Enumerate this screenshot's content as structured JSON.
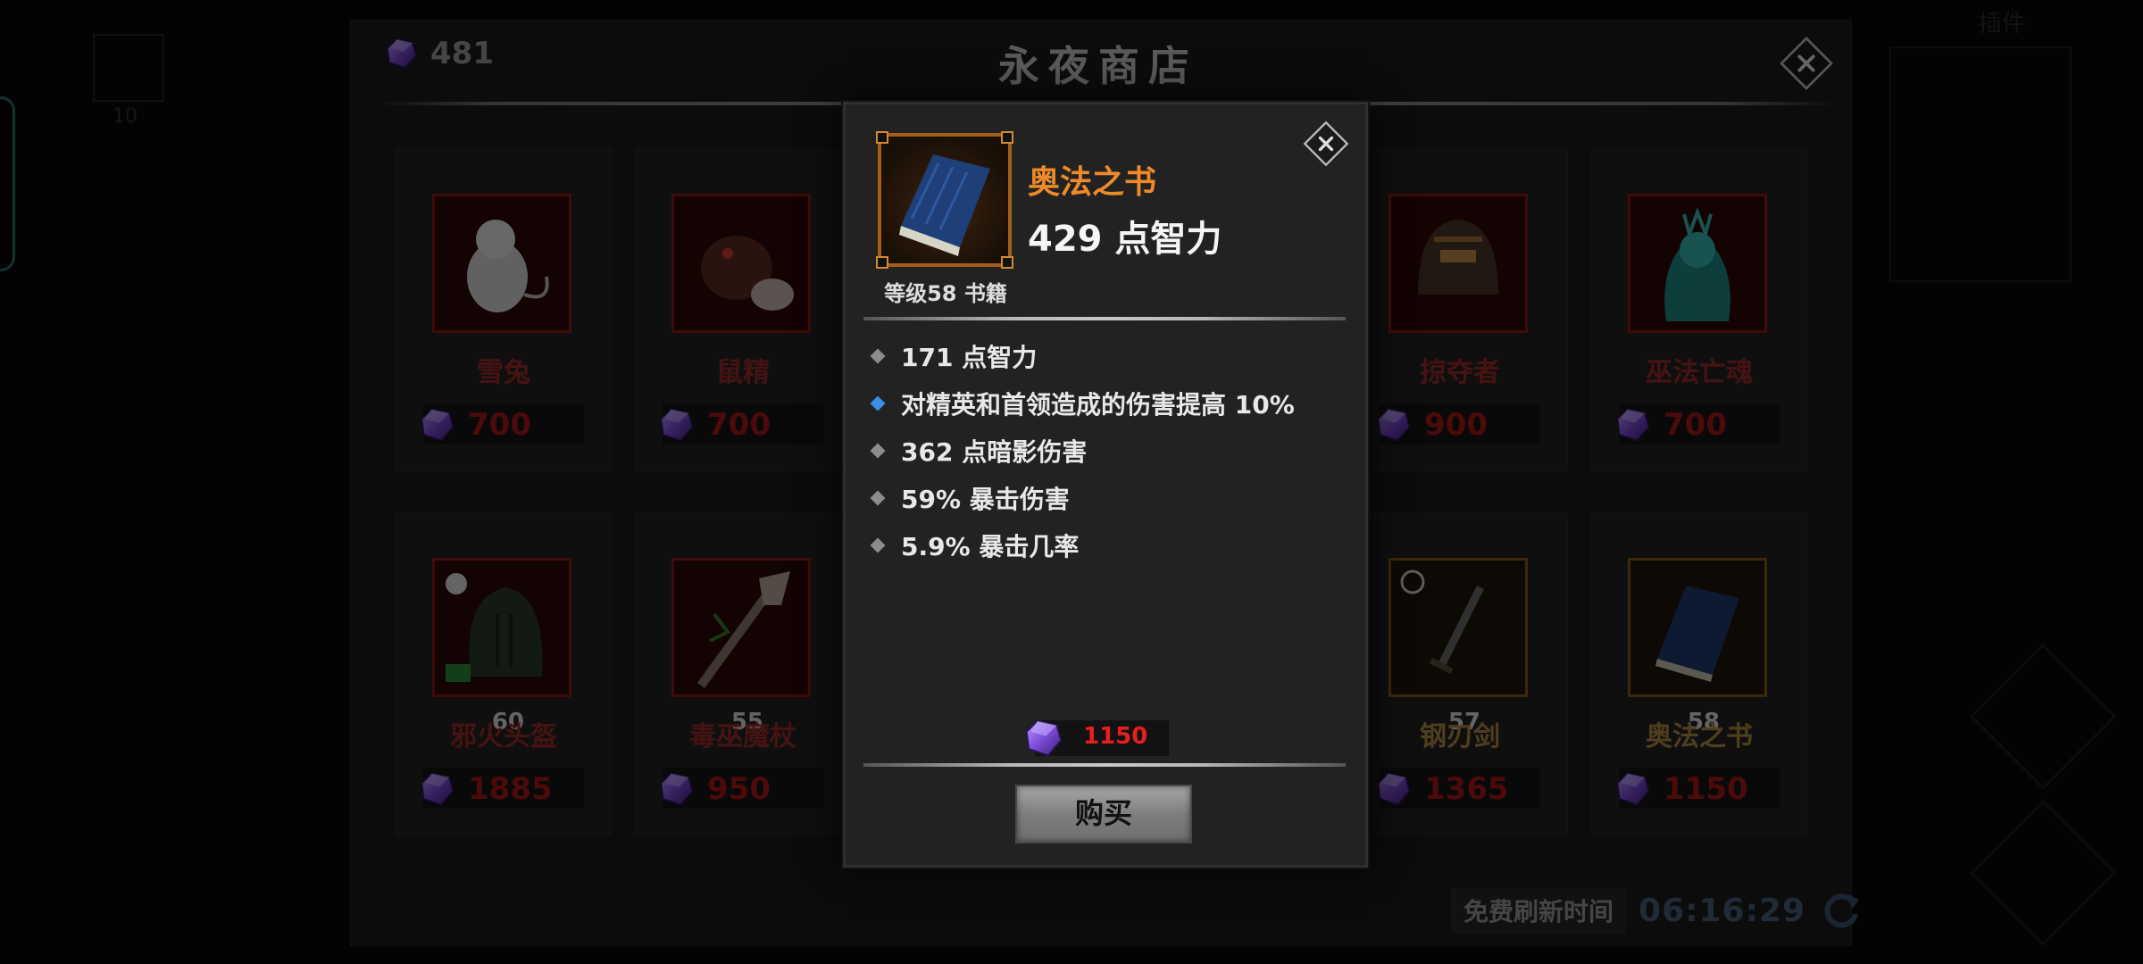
{
  "shop": {
    "title": "永夜商店",
    "currency_amount": "481",
    "refresh_label": "免费刷新时间",
    "refresh_time": "06:16:29",
    "items": [
      {
        "name": "雪兔",
        "price": "700",
        "level": "",
        "frame": "red"
      },
      {
        "name": "鼠精",
        "price": "700",
        "level": "",
        "frame": "red"
      },
      {
        "name": "掠夺者",
        "price": "900",
        "level": "",
        "frame": "red"
      },
      {
        "name": "巫法亡魂",
        "price": "700",
        "level": "",
        "frame": "red"
      },
      {
        "name": "邪火头盔",
        "price": "1885",
        "level": "60",
        "frame": "red"
      },
      {
        "name": "毒巫魔杖",
        "price": "950",
        "level": "55",
        "frame": "red"
      },
      {
        "name": "钢刃剑",
        "price": "1365",
        "level": "57",
        "frame": "gold"
      },
      {
        "name": "奥法之书",
        "price": "1150",
        "level": "58",
        "frame": "gold"
      }
    ]
  },
  "sidebar": {
    "slot_count": "10",
    "right_label": "插件"
  },
  "item_detail": {
    "name": "奥法之书",
    "main_stat": "429 点智力",
    "level_type": "等级58 书籍",
    "stats": [
      {
        "text": "171 点智力",
        "bullet": "gray"
      },
      {
        "text": "对精英和首领造成的伤害提高 10%",
        "bullet": "blue"
      },
      {
        "text": "362 点暗影伤害",
        "bullet": "gray"
      },
      {
        "text": "59% 暴击伤害",
        "bullet": "gray"
      },
      {
        "text": "5.9% 暴击几率",
        "bullet": "gray"
      }
    ],
    "cost": "1150",
    "buy_label": "购买"
  },
  "colors": {
    "accent_orange": "#ee8a2a",
    "price_red": "#e81e1e",
    "legendary_bullet": "#3a8ee6",
    "gem_purple": "#7b4bd6"
  },
  "icons": [
    "gem-icon",
    "close-icon",
    "refresh-icon",
    "book-icon"
  ]
}
